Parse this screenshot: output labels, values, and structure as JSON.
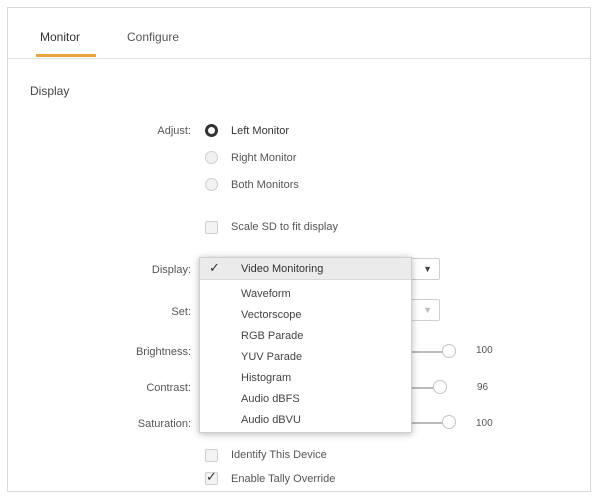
{
  "tabs": [
    {
      "label": "Monitor",
      "active": true
    },
    {
      "label": "Configure",
      "active": false
    }
  ],
  "section_title": "Display",
  "adjust": {
    "label": "Adjust:",
    "options": [
      {
        "label": "Left Monitor",
        "selected": true
      },
      {
        "label": "Right Monitor",
        "selected": false
      },
      {
        "label": "Both Monitors",
        "selected": false
      }
    ]
  },
  "scale_sd": {
    "label": "Scale SD to fit display",
    "checked": false
  },
  "display": {
    "label": "Display:",
    "selected": "Video Monitoring",
    "options": [
      "Waveform",
      "Vectorscope",
      "RGB Parade",
      "YUV Parade",
      "Histogram",
      "Audio dBFS",
      "Audio dBVU"
    ]
  },
  "set": {
    "label": "Set:"
  },
  "sliders": [
    {
      "label": "Brightness:",
      "value": "100"
    },
    {
      "label": "Contrast:",
      "value": "96"
    },
    {
      "label": "Saturation:",
      "value": "100"
    }
  ],
  "identify": {
    "label": "Identify This Device",
    "checked": false
  },
  "tally": {
    "label": "Enable Tally Override",
    "checked": true
  },
  "icons": {
    "check": "✓",
    "dropdown_arrow": "▼"
  },
  "colors": {
    "accent": "#e8a43b",
    "border": "#d9d9d9"
  }
}
